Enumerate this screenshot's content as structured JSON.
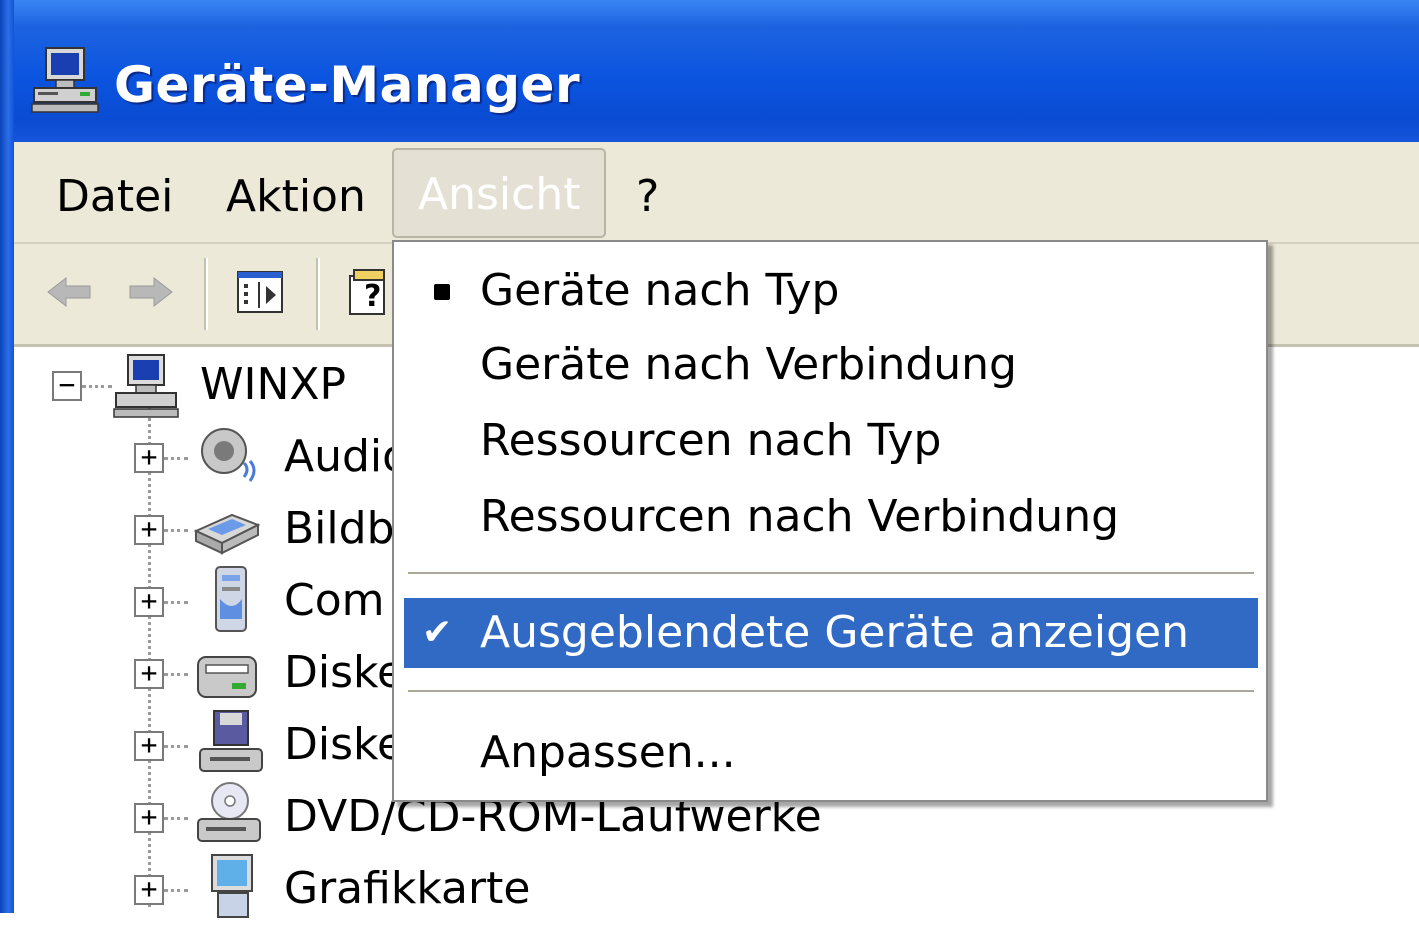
{
  "window": {
    "title": "Geräte-Manager",
    "icon": "computer-icon"
  },
  "menubar": {
    "items": [
      {
        "label": "Datei"
      },
      {
        "label": "Aktion"
      },
      {
        "label": "Ansicht",
        "active": true
      },
      {
        "label": "?"
      }
    ]
  },
  "toolbar": {
    "buttons": [
      "back-arrow-icon",
      "forward-arrow-icon",
      "show-hide-console-tree-icon",
      "properties-icon"
    ]
  },
  "tree": {
    "root": {
      "label": "WINXP",
      "icon": "computer-icon",
      "expanded": true
    },
    "children": [
      {
        "label": "Audio",
        "icon": "audio-icon"
      },
      {
        "label": "Bildbe",
        "icon": "scanner-icon"
      },
      {
        "label": "Com",
        "icon": "computer-tower-icon"
      },
      {
        "label": "Diske",
        "icon": "disk-drive-icon"
      },
      {
        "label": "Diske",
        "icon": "floppy-drive-icon"
      },
      {
        "label": "DVD/CD-ROM-Laufwerke",
        "icon": "cdrom-icon"
      },
      {
        "label": "Grafikkarte",
        "icon": "display-adapter-icon"
      }
    ]
  },
  "view_menu": {
    "items": [
      {
        "label": "Geräte nach Typ",
        "marker": "bullet"
      },
      {
        "label": "Geräte nach Verbindung"
      },
      {
        "label": "Ressourcen nach Typ"
      },
      {
        "label": "Ressourcen nach Verbindung"
      },
      {
        "label": "Ausgeblendete Geräte anzeigen",
        "marker": "check",
        "highlighted": true
      },
      {
        "label": "Anpassen..."
      }
    ],
    "check_glyph": "✔",
    "highlight_color": "#316ac5"
  },
  "colors": {
    "titlebar": "#0b54df",
    "menubar": "#ece9d8",
    "highlight": "#316ac5"
  }
}
